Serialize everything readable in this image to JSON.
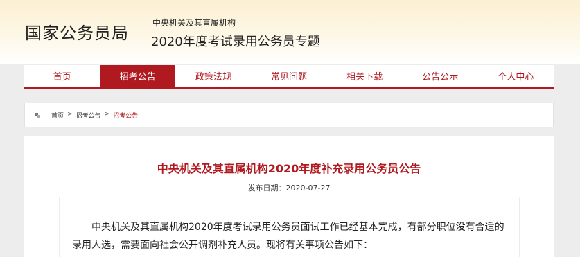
{
  "header": {
    "logo": "国家公务员局",
    "subtitle_line1": "中央机关及其直属机构",
    "subtitle_line2": "2020年度考试录用公务员专题"
  },
  "nav": {
    "items": [
      {
        "label": "首页"
      },
      {
        "label": "招考公告"
      },
      {
        "label": "政策法规"
      },
      {
        "label": "常见问题"
      },
      {
        "label": "相关下载"
      },
      {
        "label": "公告公示"
      },
      {
        "label": "个人中心"
      }
    ],
    "active_index": 1
  },
  "breadcrumb": {
    "items": [
      "首页",
      "招考公告",
      "招考公告"
    ],
    "separator": ">"
  },
  "article": {
    "title": "中央机关及其直属机构2020年度补充录用公务员公告",
    "date": "发布日期：2020-07-27",
    "paragraph": "中央机关及其直属机构2020年度考试录用公务员面试工作已经基本完成，有部分职位没有合适的录用人选，需要面向社会公开调剂补充人员。现将有关事项公告如下："
  },
  "colors": {
    "accent": "#b0191f",
    "page_bg": "#ededed",
    "header_bg": "#fbf0d2"
  }
}
